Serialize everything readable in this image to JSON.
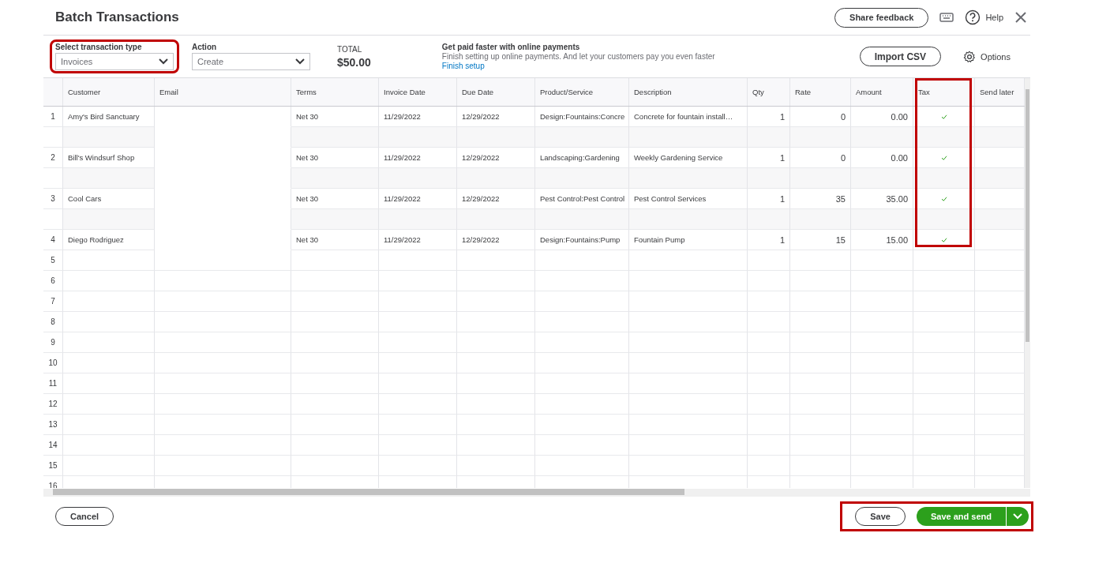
{
  "title": "Batch Transactions",
  "header": {
    "share_feedback": "Share feedback",
    "help": "Help"
  },
  "transaction_type": {
    "label": "Select transaction type",
    "value": "Invoices"
  },
  "action": {
    "label": "Action",
    "value": "Create"
  },
  "total": {
    "label": "TOTAL",
    "value": "$50.00"
  },
  "promo": {
    "title": "Get paid faster with online payments",
    "text": "Finish setting up online payments. And let your customers pay you even faster",
    "link": "Finish setup"
  },
  "import_button": "Import CSV",
  "options": "Options",
  "table": {
    "columns": [
      "Customer",
      "Email",
      "Terms",
      "Invoice Date",
      "Due Date",
      "Product/Service",
      "Description",
      "Qty",
      "Rate",
      "Amount",
      "Tax",
      "Send later"
    ],
    "rows": [
      {
        "number": "1",
        "customer": "Amy's Bird Sanctuary",
        "terms": "Net 30",
        "invoice_date": "11/29/2022",
        "due_date": "12/29/2022",
        "product": "Design:Fountains:Concre",
        "description": "Concrete for fountain install…",
        "qty": "1",
        "rate": "0",
        "amount": "0.00",
        "tax": true
      },
      {
        "number": "2",
        "customer": "Bill's Windsurf Shop",
        "terms": "Net 30",
        "invoice_date": "11/29/2022",
        "due_date": "12/29/2022",
        "product": "Landscaping:Gardening",
        "description": "Weekly Gardening Service",
        "qty": "1",
        "rate": "0",
        "amount": "0.00",
        "tax": true
      },
      {
        "number": "3",
        "customer": "Cool Cars",
        "terms": "Net 30",
        "invoice_date": "11/29/2022",
        "due_date": "12/29/2022",
        "product": "Pest Control:Pest Control",
        "description": "Pest Control Services",
        "qty": "1",
        "rate": "35",
        "amount": "35.00",
        "tax": true
      },
      {
        "number": "4",
        "customer": "Diego Rodriguez",
        "terms": "Net 30",
        "invoice_date": "11/29/2022",
        "due_date": "12/29/2022",
        "product": "Design:Fountains:Pump",
        "description": "Fountain Pump",
        "qty": "1",
        "rate": "15",
        "amount": "15.00",
        "tax": true
      }
    ],
    "empty_rows": [
      "5",
      "6",
      "7",
      "8",
      "9",
      "10",
      "11",
      "12",
      "13",
      "14",
      "15",
      "16"
    ]
  },
  "footer": {
    "cancel": "Cancel",
    "save": "Save",
    "save_and_send": "Save and send"
  }
}
